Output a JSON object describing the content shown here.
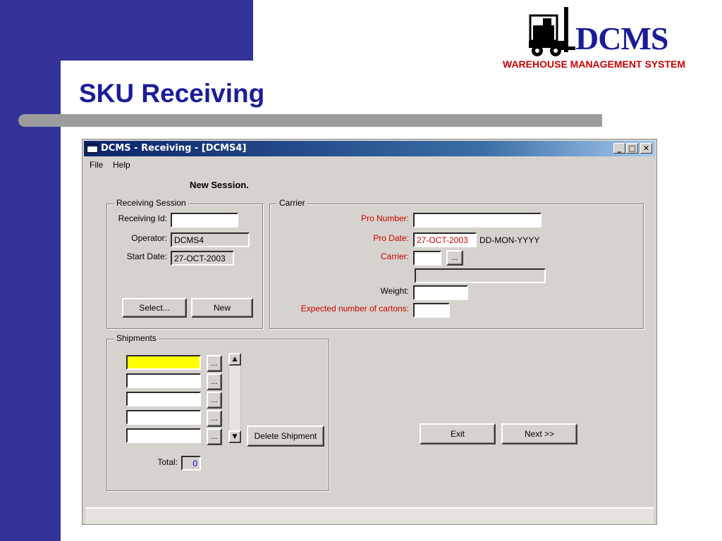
{
  "slide": {
    "title": "SKU Receiving",
    "logo_text": "DCMS",
    "logo_subtitle": "WAREHOUSE MANAGEMENT SYSTEM"
  },
  "window": {
    "title": "DCMS - Receiving - [DCMS4]",
    "controls": {
      "minimize": "_",
      "maximize": "□",
      "close": "✕"
    },
    "menu": [
      "File",
      "Help"
    ],
    "session_label": "New Session."
  },
  "receiving_session": {
    "title": "Receiving Session",
    "receiving_id_label": "Receiving Id:",
    "receiving_id_value": "",
    "operator_label": "Operator:",
    "operator_value": "DCMS4",
    "start_date_label": "Start Date:",
    "start_date_value": "27-OCT-2003",
    "select_button": "Select...",
    "new_button": "New"
  },
  "carrier": {
    "title": "Carrier",
    "pro_number_label": "Pro Number:",
    "pro_number_value": "",
    "pro_date_label": "Pro Date:",
    "pro_date_value": "27-OCT-2003",
    "date_format_hint": "DD-MON-YYYY",
    "carrier_label": "Carrier:",
    "carrier_value": "",
    "carrier_lookup_button": "...",
    "carrier_name_value": "",
    "weight_label": "Weight:",
    "weight_value": "",
    "expected_cartons_label": "Expected number of cartons:",
    "expected_cartons_value": ""
  },
  "shipments": {
    "title": "Shipments",
    "rows": [
      {
        "value": "",
        "button": "..."
      },
      {
        "value": "",
        "button": "..."
      },
      {
        "value": "",
        "button": "..."
      },
      {
        "value": "",
        "button": "..."
      },
      {
        "value": "",
        "button": "..."
      }
    ],
    "delete_button": "Delete Shipment",
    "total_label": "Total:",
    "total_value": "0"
  },
  "actions": {
    "exit_button": "Exit",
    "next_button": "Next >>"
  },
  "colors": {
    "slide_blue": "#333399",
    "title_blue": "#1c1c99",
    "required_label_red": "#cc0000",
    "active_row_yellow": "#ffff00",
    "window_face": "#d6d3ce"
  }
}
